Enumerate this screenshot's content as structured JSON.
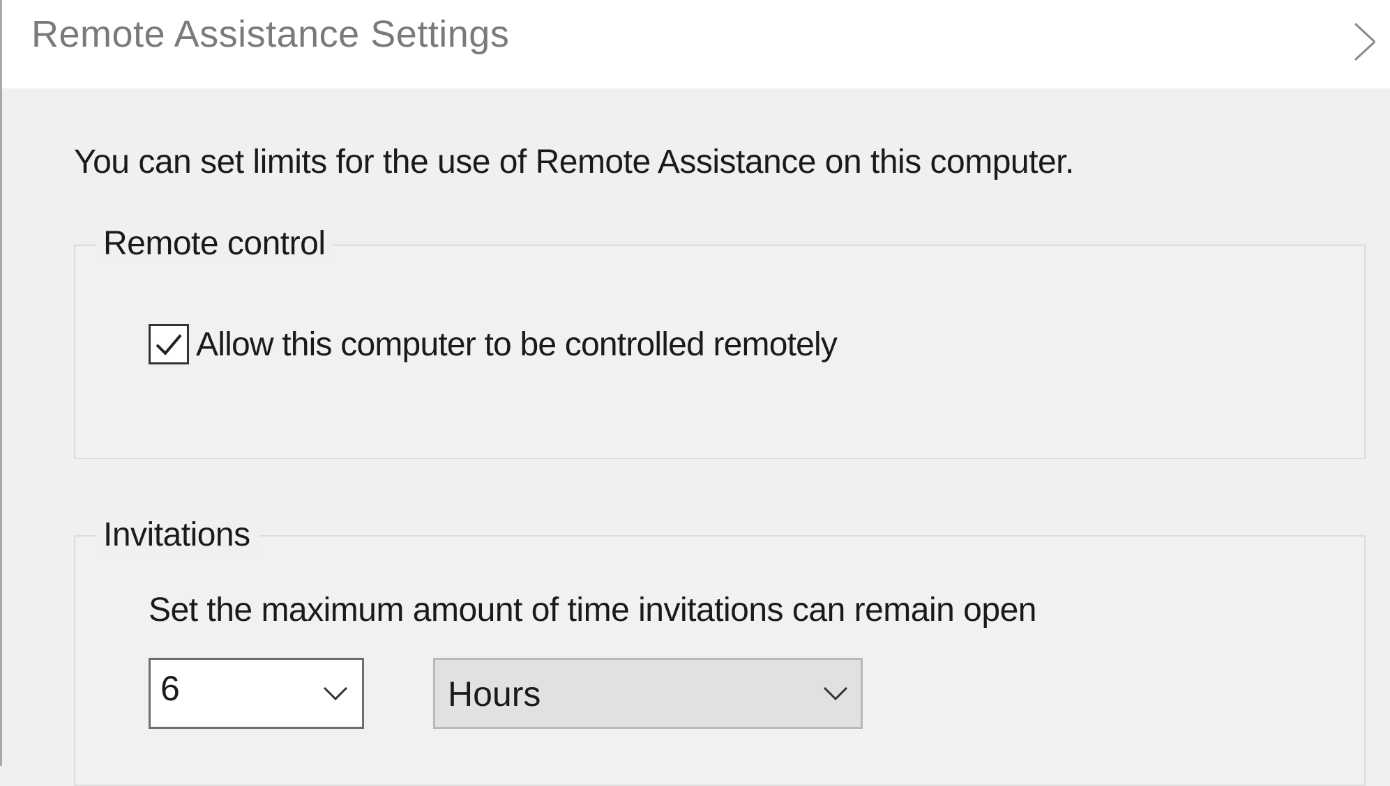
{
  "window": {
    "title": "Remote Assistance Settings"
  },
  "intro_text": "You can set limits for the use of Remote Assistance on this computer.",
  "remote_control": {
    "legend": "Remote control",
    "allow_checkbox": {
      "label": "Allow this computer to be controlled remotely",
      "checked": true
    }
  },
  "invitations": {
    "legend": "Invitations",
    "description": "Set the maximum amount of time invitations can remain open",
    "duration_value": "6",
    "duration_unit": "Hours"
  },
  "icons": {
    "close": "close-icon",
    "checkmark": "checkmark-icon",
    "dropdown": "chevron-down-icon"
  }
}
